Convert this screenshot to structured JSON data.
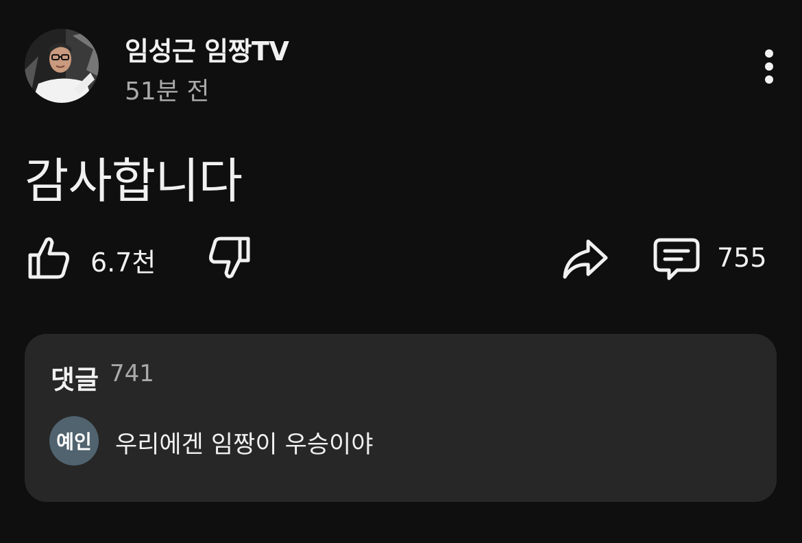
{
  "post": {
    "channel_name": "임성근 임짱TV",
    "time": "51분 전",
    "text": "감사합니다",
    "avatar_icon": "channel-avatar-photo"
  },
  "actions": {
    "likes": "6.7천",
    "comments_count": "755",
    "like_icon": "thumbs-up-icon",
    "dislike_icon": "thumbs-down-icon",
    "share_icon": "share-icon",
    "comment_icon": "comment-icon",
    "more_icon": "more-vertical-icon"
  },
  "comments": {
    "title": "댓글",
    "count": "741",
    "top_comment": {
      "avatar_initials": "예인",
      "avatar_color": "#50636f",
      "text": "우리에겐 임짱이 우승이야"
    }
  },
  "colors": {
    "background": "#0f0f0f",
    "panel": "#272727",
    "secondary_text": "#aaaaaa"
  }
}
